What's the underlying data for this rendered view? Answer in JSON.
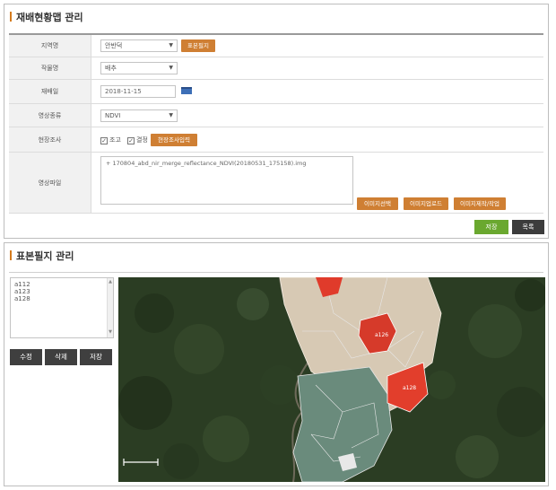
{
  "panel1": {
    "title": "재배현황맵 관리",
    "fields": {
      "region": {
        "label": "지역명",
        "value": "안반덕",
        "button": "표본필지"
      },
      "crop": {
        "label": "작물명",
        "value": "배추"
      },
      "date": {
        "label": "재배일",
        "value": "2018-11-15"
      },
      "image_type": {
        "label": "영상종류",
        "value": "NDVI"
      },
      "survey": {
        "label": "현장조사",
        "check1": "조고",
        "check2": "결정",
        "button": "현장조사입력"
      },
      "image_file": {
        "label": "영상파일",
        "file": "+ 170804_abd_nir_merge_reflectance_NDVI(20180531_175158).img",
        "btn_select": "이미지선택",
        "btn_upload": "이미지업로드",
        "btn_make": "이미지제작/작업"
      }
    },
    "save_label": "저장",
    "list_label": "목록"
  },
  "panel2": {
    "title": "표본필지 관리",
    "items": [
      "a112",
      "a123",
      "a128"
    ],
    "edit_label": "수정",
    "delete_label": "삭제",
    "save_label": "저장",
    "map_labels": [
      "a126",
      "a128"
    ]
  },
  "colors": {
    "accent": "#cf7f33",
    "green": "#6aa82f",
    "dark": "#3c3c3c",
    "red_parcel": "#e03b2b"
  }
}
